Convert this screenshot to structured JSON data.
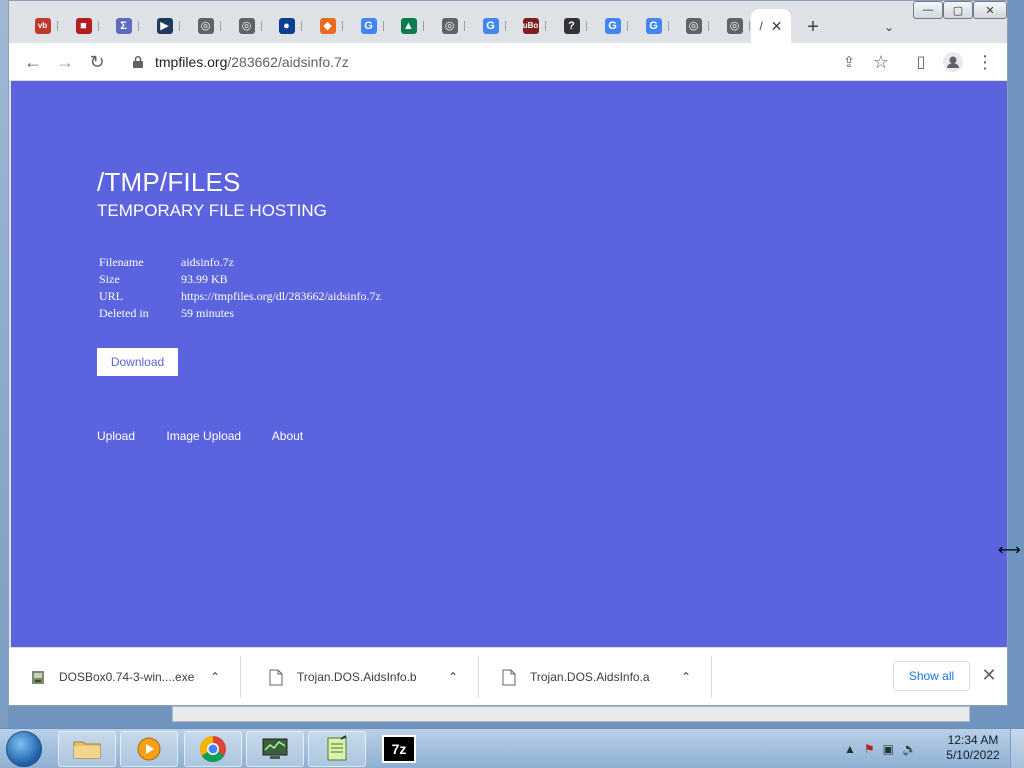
{
  "browser": {
    "tabs": [
      {
        "favicon": "vb",
        "color": "#c0392b"
      },
      {
        "favicon": "■",
        "color": "#b71c1c"
      },
      {
        "favicon": "Σ",
        "color": "#5c6bc0"
      },
      {
        "favicon": "▶",
        "color": "#1e3a5f"
      },
      {
        "favicon": "◎",
        "color": "#5f6368"
      },
      {
        "favicon": "◎",
        "color": "#5f6368"
      },
      {
        "favicon": "●",
        "color": "#0b3d91"
      },
      {
        "favicon": "◆",
        "color": "#e86c1f"
      },
      {
        "favicon": "G",
        "color": "#4285f4"
      },
      {
        "favicon": "▲",
        "color": "#0c7b4e"
      },
      {
        "favicon": "◎",
        "color": "#5f6368"
      },
      {
        "favicon": "G",
        "color": "#4285f4"
      },
      {
        "favicon": "uBo",
        "color": "#7b1f1f"
      },
      {
        "favicon": "?",
        "color": "#333333"
      },
      {
        "favicon": "G",
        "color": "#4285f4"
      },
      {
        "favicon": "G",
        "color": "#4285f4"
      },
      {
        "favicon": "◎",
        "color": "#5f6368"
      },
      {
        "favicon": "◎",
        "color": "#5f6368"
      }
    ],
    "active_tab": {
      "title": "/",
      "close": "✕"
    },
    "new_tab": "+",
    "tab_search": "⌄",
    "window_controls": {
      "minimize": "—",
      "maximize": "▢",
      "close": "✕"
    },
    "toolbar": {
      "back": "←",
      "forward": "→",
      "reload": "↻",
      "url_host": "tmpfiles.org",
      "url_path": "/283662/aidsinfo.7z",
      "share": "⇪",
      "star": "☆",
      "sidepanel": "▯",
      "profile": "●",
      "menu": "⋮"
    }
  },
  "page": {
    "title": "/TMP/FILES",
    "subtitle": "TEMPORARY FILE HOSTING",
    "info": [
      {
        "key": "Filename",
        "value": "aidsinfo.7z"
      },
      {
        "key": "Size",
        "value": "93.99 KB"
      },
      {
        "key": "URL",
        "value": "https://tmpfiles.org/dl/283662/aidsinfo.7z"
      },
      {
        "key": "Deleted in",
        "value": "59 minutes"
      }
    ],
    "download_label": "Download",
    "footer_links": [
      "Upload",
      "Image Upload",
      "About"
    ],
    "background_color": "#5b64de"
  },
  "downloads": {
    "items": [
      {
        "name": "DOSBox0.74-3-win....exe",
        "icon": "installer-icon"
      },
      {
        "name": "Trojan.DOS.AidsInfo.b",
        "icon": "file-icon"
      },
      {
        "name": "Trojan.DOS.AidsInfo.a",
        "icon": "file-icon"
      }
    ],
    "chevron": "⌃",
    "show_all": "Show all",
    "close": "✕"
  },
  "taskbar": {
    "apps": [
      "explorer",
      "media-player",
      "chrome",
      "network-monitor",
      "notepad",
      "7zip"
    ],
    "app_7zip_label": "7z",
    "tray": {
      "arrow": "▲",
      "flag": "⚑",
      "network": "▣",
      "volume": "🔈"
    },
    "time": "12:34 AM",
    "date": "5/10/2022"
  },
  "cursor": "⟷"
}
